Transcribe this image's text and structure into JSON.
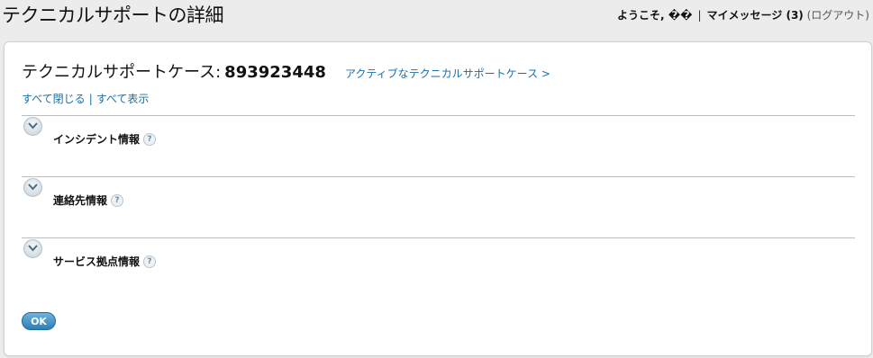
{
  "page": {
    "title": "テクニカルサポートの詳細"
  },
  "user_bar": {
    "welcome": "ようこそ, ��",
    "messages": "マイメッセージ (3)",
    "logout": "(ログアウト)"
  },
  "case": {
    "label": "テクニカルサポートケース:",
    "number": "893923448",
    "active_link": "アクティブなテクニカルサポートケース >"
  },
  "toggles": {
    "collapse_all": "すべて閉じる",
    "expand_all": "すべて表示",
    "divider": "|"
  },
  "sections": [
    {
      "title": "インシデント情報"
    },
    {
      "title": "連絡先情報"
    },
    {
      "title": "サービス拠点情報"
    }
  ],
  "help_glyph": "?",
  "ok_button": "OK",
  "colors": {
    "link": "#1a6fa8",
    "button": "#2c7fb5",
    "background": "#ececec"
  }
}
